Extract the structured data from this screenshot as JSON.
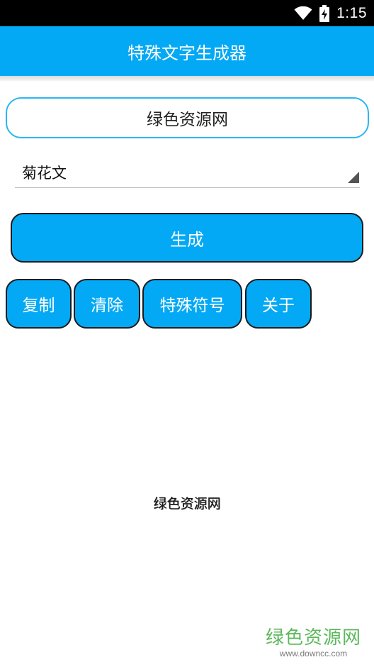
{
  "status_bar": {
    "time": "1:15",
    "icons": [
      "wifi-icon",
      "battery-charging-icon"
    ]
  },
  "app_bar": {
    "title": "特殊文字生成器"
  },
  "input": {
    "value": "绿色资源网"
  },
  "style_select": {
    "selected": "菊花文"
  },
  "buttons": {
    "generate": "生成",
    "copy": "复制",
    "clear": "清除",
    "special_symbols": "特殊符号",
    "about": "关于"
  },
  "result": {
    "text": "绿色资源网"
  },
  "watermark": {
    "title": "绿色资源网",
    "url": "www.downcc.com"
  },
  "colors": {
    "primary": "#03a9f4",
    "input_border": "#29b6f6",
    "watermark": "#5cb85c"
  }
}
